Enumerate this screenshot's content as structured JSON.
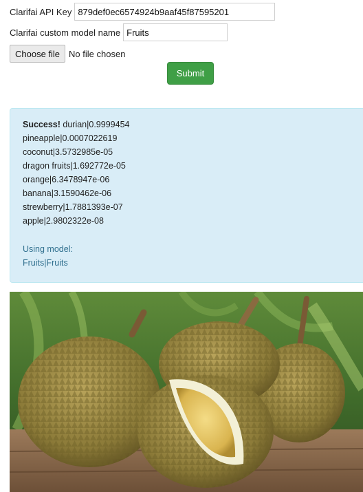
{
  "form": {
    "api_key_label": "Clarifai API Key",
    "api_key_value": "879def0ec6574924b9aaf45f87595201",
    "model_name_label": "Clarifai custom model name",
    "model_name_value": "Fruits",
    "choose_file_label": "Choose file",
    "file_status": "No file chosen",
    "submit_label": "Submit"
  },
  "result": {
    "success_label": "Success!",
    "predictions": [
      "durian|0.9999454",
      "pineapple|0.0007022619",
      "coconut|3.5732985e-05",
      "dragon fruits|1.692772e-05",
      "orange|6.3478947e-06",
      "banana|3.1590462e-06",
      "strewberry|1.7881393e-07",
      "apple|2.9802322e-08"
    ],
    "model_heading": "Using model:",
    "model_value": "Fruits|Fruits"
  },
  "image": {
    "subject": "durian fruits on wooden table"
  },
  "colors": {
    "submit_bg": "#3f9f46",
    "alert_bg": "#d9edf7",
    "alert_text": "#31708f"
  }
}
